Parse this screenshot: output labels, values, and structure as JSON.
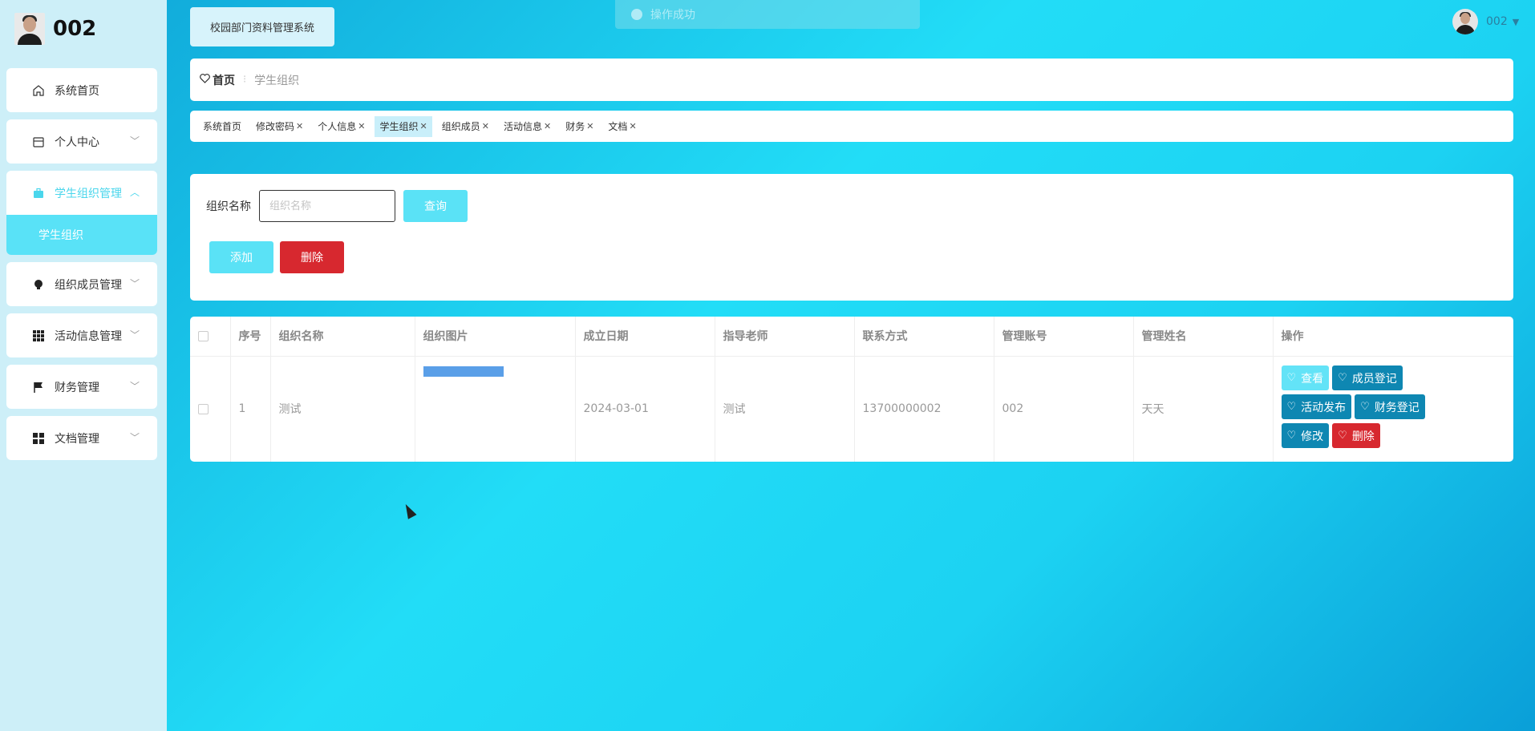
{
  "brand": {
    "name": "002"
  },
  "sidebar": {
    "items": [
      {
        "label": "系统首页",
        "icon": "home-icon"
      },
      {
        "label": "个人中心",
        "icon": "calendar-icon"
      },
      {
        "label": "学生组织管理",
        "icon": "briefcase-icon",
        "active": true,
        "children": [
          {
            "label": "学生组织"
          }
        ]
      },
      {
        "label": "组织成员管理",
        "icon": "bulb-icon"
      },
      {
        "label": "活动信息管理",
        "icon": "grid-icon"
      },
      {
        "label": "财务管理",
        "icon": "flag-icon"
      },
      {
        "label": "文档管理",
        "icon": "apps-icon"
      }
    ]
  },
  "header": {
    "system_title": "校园部门资料管理系统",
    "toast": "操作成功",
    "user": "002"
  },
  "breadcrumb": {
    "home": "首页",
    "separator": "⁝",
    "current": "学生组织"
  },
  "tags": [
    {
      "label": "系统首页",
      "closable": false
    },
    {
      "label": "修改密码",
      "closable": true
    },
    {
      "label": "个人信息",
      "closable": true
    },
    {
      "label": "学生组织",
      "closable": true,
      "active": true
    },
    {
      "label": "组织成员",
      "closable": true
    },
    {
      "label": "活动信息",
      "closable": true
    },
    {
      "label": "财务",
      "closable": true
    },
    {
      "label": "文档",
      "closable": true
    }
  ],
  "search": {
    "label": "组织名称",
    "placeholder": "组织名称",
    "value": "",
    "query_label": "查询",
    "add_label": "添加",
    "delete_label": "删除"
  },
  "table": {
    "columns": [
      "序号",
      "组织名称",
      "组织图片",
      "成立日期",
      "指导老师",
      "联系方式",
      "管理账号",
      "管理姓名",
      "操作"
    ],
    "rows": [
      {
        "index": "1",
        "name": "测试",
        "founded": "2024-03-01",
        "teacher": "测试",
        "contact": "13700000002",
        "account": "002",
        "manager": "天天"
      }
    ],
    "actions": [
      "查看",
      "成员登记",
      "活动发布",
      "财务登记",
      "修改",
      "删除"
    ]
  },
  "colors": {
    "accent": "#5ae2f6",
    "primary_dark": "#0e87b2",
    "danger": "#d7282f",
    "sidebar_bg": "#cdeff8"
  }
}
